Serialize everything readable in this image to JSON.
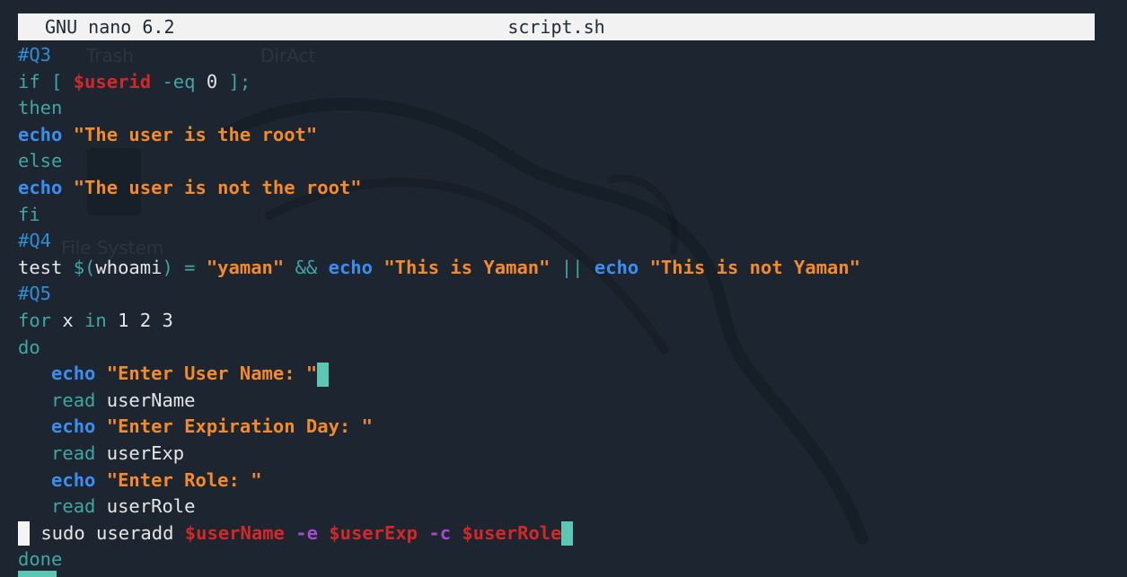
{
  "header": {
    "app_name": "GNU nano 6.2",
    "file_name": "script.sh"
  },
  "desktop": {
    "trash_label": "Trash",
    "diract_label": "DirAct",
    "filesystem_label": "File System"
  },
  "lines": {
    "l1": {
      "a": "#Q3"
    },
    "l2": {
      "a": "if [ ",
      "b": "$userid",
      "c": " -eq ",
      "d": "0",
      "e": " ];"
    },
    "l3": {
      "a": "then"
    },
    "l4": {
      "a": "echo",
      "b": " ",
      "c": "\"The user is the root\""
    },
    "l5": {
      "a": "else"
    },
    "l6": {
      "a": "echo",
      "b": " ",
      "c": "\"The user is not the root\""
    },
    "l7": {
      "a": "fi"
    },
    "l8": {
      "a": "#Q4"
    },
    "l9": {
      "a": "test ",
      "b": "$(",
      "c": "whoami",
      "d": ") = ",
      "e": "\"yaman\"",
      "f": " && ",
      "g": "echo",
      "h": " ",
      "i": "\"This is Yaman\"",
      "j": " || ",
      "k": "echo",
      "l": " ",
      "m": "\"This is not Yaman\""
    },
    "l10": {
      "a": "#Q5"
    },
    "l11": {
      "a": "for",
      "b": " x ",
      "c": "in",
      "d": " 1 2 3"
    },
    "l12": {
      "a": "do"
    },
    "l13": {
      "a": "   ",
      "b": "echo",
      "c": " ",
      "d": "\"Enter User Name: \""
    },
    "l14": {
      "a": "   ",
      "b": "read",
      "c": " userName"
    },
    "l15": {
      "a": "   ",
      "b": "echo",
      "c": " ",
      "d": "\"Enter Expiration Day: \""
    },
    "l16": {
      "a": "   ",
      "b": "read",
      "c": " userExp"
    },
    "l17": {
      "a": "   ",
      "b": "echo",
      "c": " ",
      "d": "\"Enter Role: \""
    },
    "l18": {
      "a": "   ",
      "b": "read",
      "c": " userRole"
    },
    "l19": {
      "a": " sudo useradd ",
      "b": "$userName",
      "c": " ",
      "d": "-e",
      "e": " ",
      "f": "$userExp",
      "g": " ",
      "h": "-c",
      "i": " ",
      "j": "$userRole"
    },
    "l20": {
      "a": "done"
    }
  },
  "colors": {
    "background": "#1c2530",
    "header_bg": "#f2f2f2",
    "comment": "#2f8ed3",
    "keyword": "#3fa7a4",
    "echo": "#3b8ef0",
    "string": "#f58a28",
    "variable": "#d42727",
    "option": "#a54bd2",
    "cursor": "#5cc6b4"
  }
}
